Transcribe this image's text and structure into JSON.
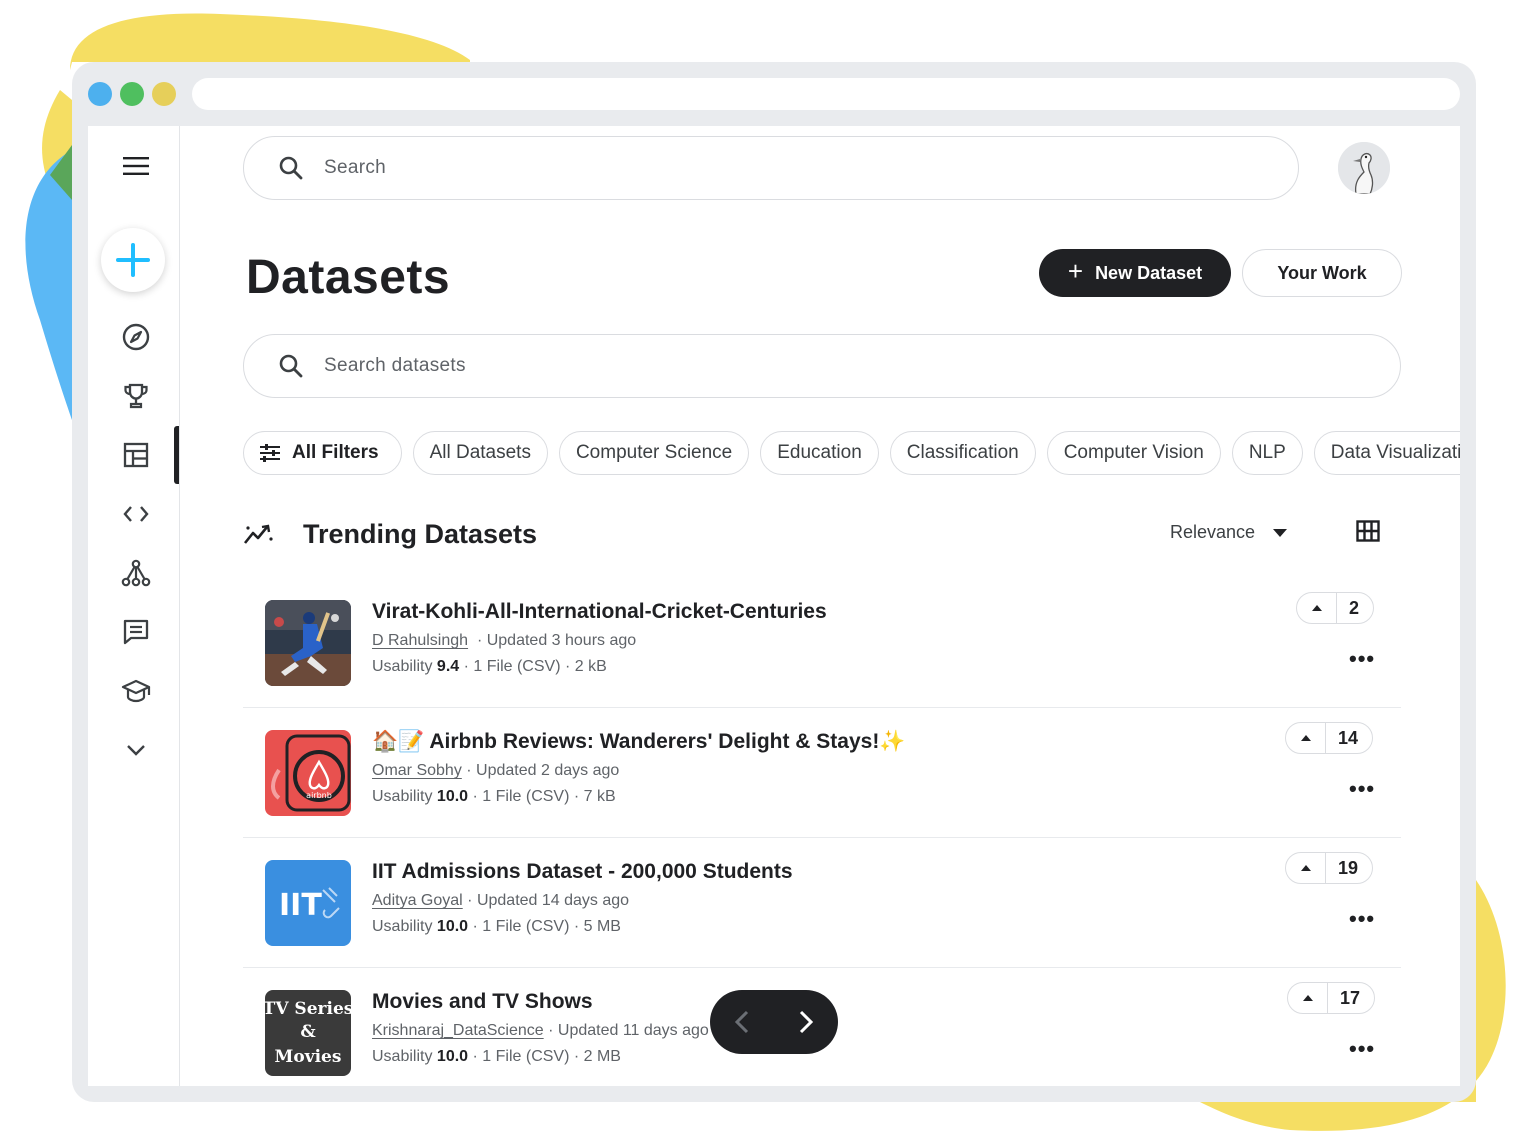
{
  "colors": {
    "blob_yellow": "#f5de63",
    "blob_blue": "#5bb8f5",
    "blob_green": "#5aa65a",
    "dot_blue": "#4db0ee",
    "dot_green": "#4fbf5f",
    "dot_yellow": "#e6cf5a",
    "accent_blue": "#20beff",
    "text_dark": "#202124"
  },
  "sidebar": {
    "items": [
      {
        "icon": "menu-icon"
      },
      {
        "icon": "plus-icon",
        "label": "Create"
      },
      {
        "icon": "compass-icon"
      },
      {
        "icon": "trophy-icon"
      },
      {
        "icon": "table-icon",
        "active": true
      },
      {
        "icon": "code-icon"
      },
      {
        "icon": "models-icon"
      },
      {
        "icon": "comment-icon"
      },
      {
        "icon": "graduation-cap-icon"
      },
      {
        "icon": "chevron-down-icon"
      }
    ]
  },
  "header": {
    "search_placeholder": "Search"
  },
  "page": {
    "title": "Datasets",
    "new_dataset_label": "New Dataset",
    "your_work_label": "Your Work",
    "search_datasets_placeholder": "Search datasets",
    "chips": [
      "All Filters",
      "All Datasets",
      "Computer Science",
      "Education",
      "Classification",
      "Computer Vision",
      "NLP",
      "Data Visualization"
    ],
    "section_title": "Trending Datasets",
    "sort_label": "Relevance"
  },
  "datasets": [
    {
      "title": "Virat-Kohli-All-International-Cricket-Centuries",
      "owner": "D Rahulsingh",
      "updated": "· Updated 3 hours ago",
      "usability_label": "Usability",
      "usability": "9.4",
      "details": "· 1 File (CSV) · 2 kB",
      "votes": "2"
    },
    {
      "title": "🏠📝 Airbnb Reviews: Wanderers' Delight & Stays!✨",
      "owner": "Omar Sobhy",
      "updated": "· Updated 2 days ago",
      "usability_label": "Usability",
      "usability": "10.0",
      "details": "· 1 File (CSV) · 7 kB",
      "votes": "14"
    },
    {
      "title": "IIT Admissions Dataset - 200,000 Students",
      "owner": "Aditya Goyal",
      "updated": "· Updated 14 days ago",
      "usability_label": "Usability",
      "usability": "10.0",
      "details": "· 1 File (CSV) · 5 MB",
      "votes": "19",
      "thumb_text": "IIT"
    },
    {
      "title": "Movies and TV Shows",
      "owner": "Krishnaraj_DataScience",
      "updated": "· Updated 11 days ago",
      "usability_label": "Usability",
      "usability": "10.0",
      "details": "· 1 File (CSV) · 2 MB",
      "votes": "17",
      "thumb_lines": [
        "TV Series",
        "&",
        "Movies"
      ]
    }
  ]
}
